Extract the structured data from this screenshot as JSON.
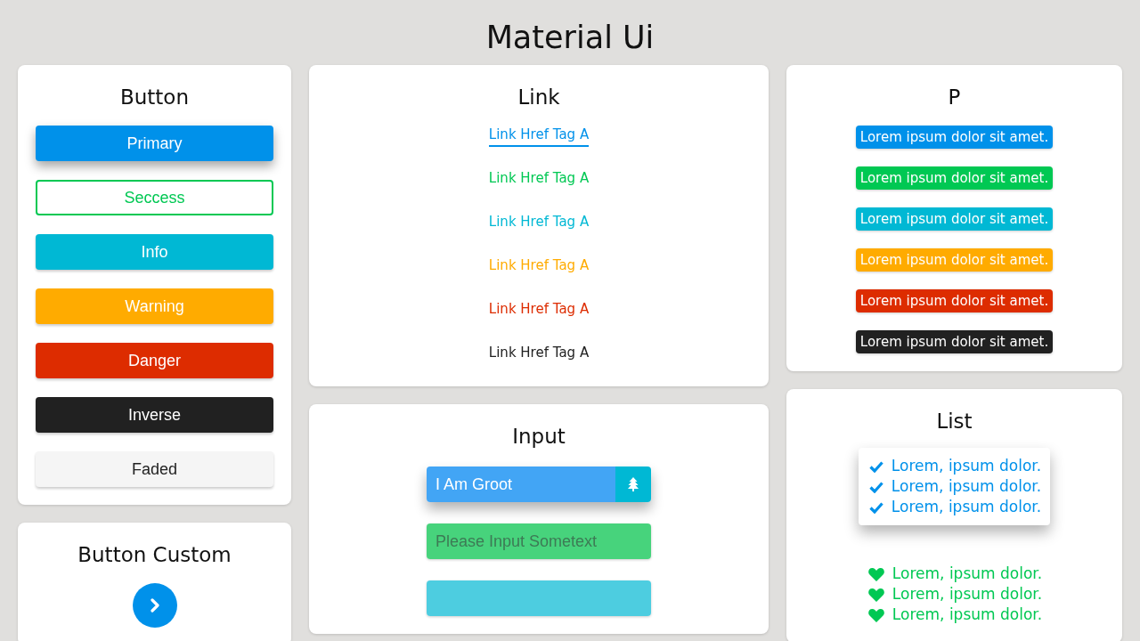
{
  "title": "Material Ui",
  "button_card": {
    "title": "Button",
    "buttons": [
      {
        "label": "Primary",
        "kind": "raised",
        "color": "#0091ea"
      },
      {
        "label": "Seccess",
        "kind": "outlined",
        "color": "#00c853"
      },
      {
        "label": "Info",
        "kind": "filled",
        "color": "#00b8d4"
      },
      {
        "label": "Warning",
        "kind": "filled",
        "color": "#ffab00"
      },
      {
        "label": "Danger",
        "kind": "filled",
        "color": "#dd2c00"
      },
      {
        "label": "Inverse",
        "kind": "filled",
        "color": "#212121"
      },
      {
        "label": "Faded",
        "kind": "filled",
        "color": "#f5f5f5"
      }
    ]
  },
  "button_custom": {
    "title": "Button Custom",
    "color": "#0091ea"
  },
  "link_card": {
    "title": "Link",
    "links": [
      {
        "label": "Link Href Tag A",
        "color": "#0091ea",
        "selected": true
      },
      {
        "label": "Link Href Tag A",
        "color": "#00c853",
        "selected": false
      },
      {
        "label": "Link Href Tag A",
        "color": "#00b8d4",
        "selected": false
      },
      {
        "label": "Link Href Tag A",
        "color": "#ffab00",
        "selected": false
      },
      {
        "label": "Link Href Tag A",
        "color": "#dd2c00",
        "selected": false
      },
      {
        "label": "Link Href Tag A",
        "color": "#212121",
        "selected": false
      }
    ]
  },
  "p_card": {
    "title": "P",
    "paragraphs": [
      {
        "text": "Lorem ipsum dolor sit amet.",
        "color": "#0091ea"
      },
      {
        "text": "Lorem ipsum dolor sit amet.",
        "color": "#00c853"
      },
      {
        "text": "Lorem ipsum dolor sit amet.",
        "color": "#00b8d4"
      },
      {
        "text": "Lorem ipsum dolor sit amet.",
        "color": "#ffab00"
      },
      {
        "text": "Lorem ipsum dolor sit amet.",
        "color": "#dd2c00"
      },
      {
        "text": "Lorem ipsum dolor sit amet.",
        "color": "#212121"
      }
    ]
  },
  "input_card": {
    "title": "Input",
    "fields": [
      {
        "kind": "addon",
        "value": "I Am Groot",
        "color": "#42a5f5"
      },
      {
        "kind": "plain",
        "placeholder": "Please Input Sometext",
        "color": "#47d37c"
      },
      {
        "kind": "plain",
        "color": "#4dcde0"
      }
    ]
  },
  "list_card": {
    "title": "List",
    "lists": [
      {
        "kind": "check",
        "color": "#0091ea",
        "items": [
          "Lorem, ipsum dolor.",
          "Lorem, ipsum dolor.",
          "Lorem, ipsum dolor."
        ]
      },
      {
        "kind": "heart",
        "color": "#00c853",
        "items": [
          "Lorem, ipsum dolor.",
          "Lorem, ipsum dolor.",
          "Lorem, ipsum dolor."
        ]
      }
    ]
  }
}
